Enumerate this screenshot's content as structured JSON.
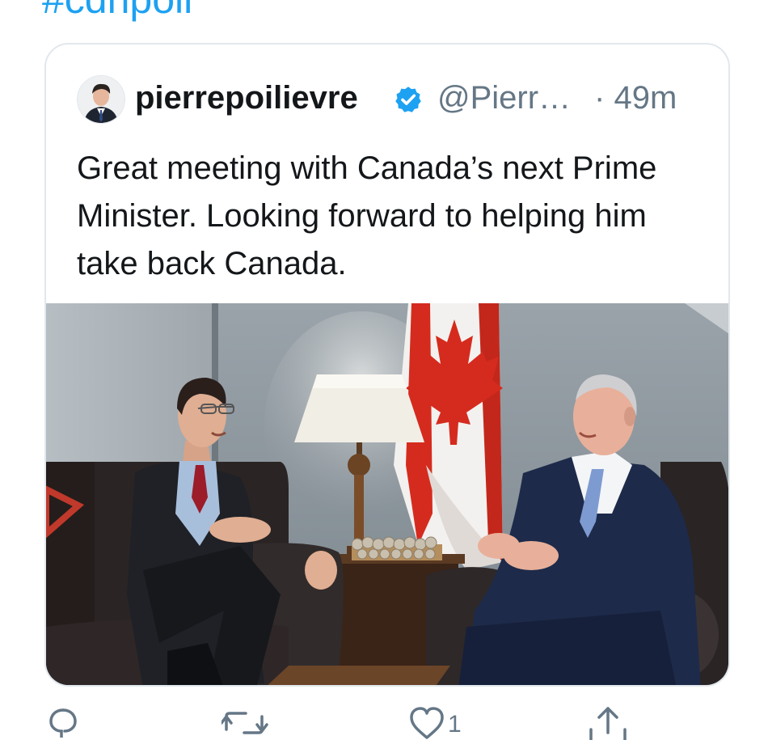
{
  "previous_tweet": {
    "hashtag": "#cdnpoli"
  },
  "quoted_tweet": {
    "author": {
      "display_name": "pierrepoilievre",
      "handle": "@Pierr…",
      "verified": true,
      "avatar_icon": "avatar-photo"
    },
    "time_separator": "·",
    "time": "49m",
    "text": "Great meeting with Canada’s next Prime Minister. Looking forward to helping him take back Canada.",
    "media": {
      "type": "photo"
    }
  },
  "actions": {
    "reply_icon": "reply-icon",
    "retweet_icon": "retweet-icon",
    "like_icon": "heart-icon",
    "like_count": "1",
    "share_icon": "share-icon"
  },
  "colors": {
    "link": "#1da1f2",
    "secondary_text": "#657786",
    "primary_text": "#14171a",
    "card_border": "#e1e8ed",
    "verified": "#1da1f2",
    "canada_red": "#d52b1e"
  }
}
